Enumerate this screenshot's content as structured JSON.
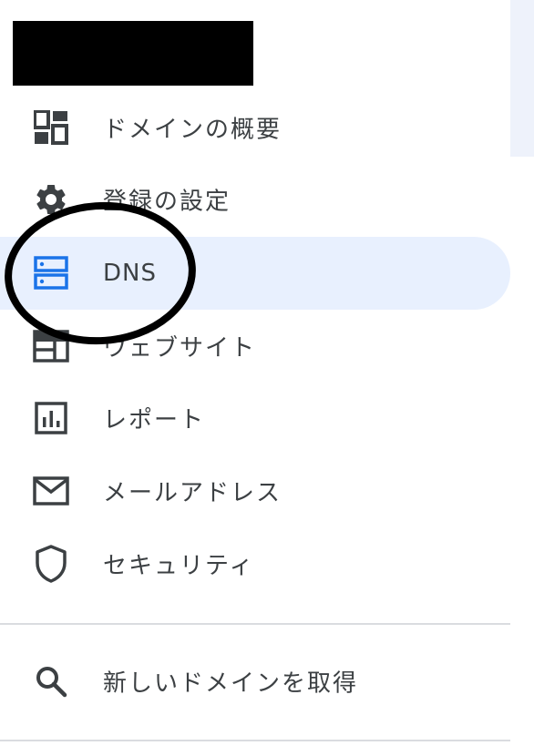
{
  "nav": {
    "items": [
      {
        "label": "ドメインの概要",
        "icon": "dashboard-icon"
      },
      {
        "label": "登録の設定",
        "icon": "gear-icon"
      },
      {
        "label": "DNS",
        "icon": "dns-icon",
        "active": true
      },
      {
        "label": "ウェブサイト",
        "icon": "website-icon"
      },
      {
        "label": "レポート",
        "icon": "report-icon"
      },
      {
        "label": "メールアドレス",
        "icon": "mail-icon"
      },
      {
        "label": "セキュリティ",
        "icon": "shield-icon"
      }
    ],
    "search_item": {
      "label": "新しいドメインを取得",
      "icon": "search-icon"
    }
  },
  "colors": {
    "active_bg": "#e8f0fe",
    "active_icon": "#1a73e8",
    "icon": "#3c4043",
    "divider": "#dadce0",
    "annotation": "#000000"
  }
}
